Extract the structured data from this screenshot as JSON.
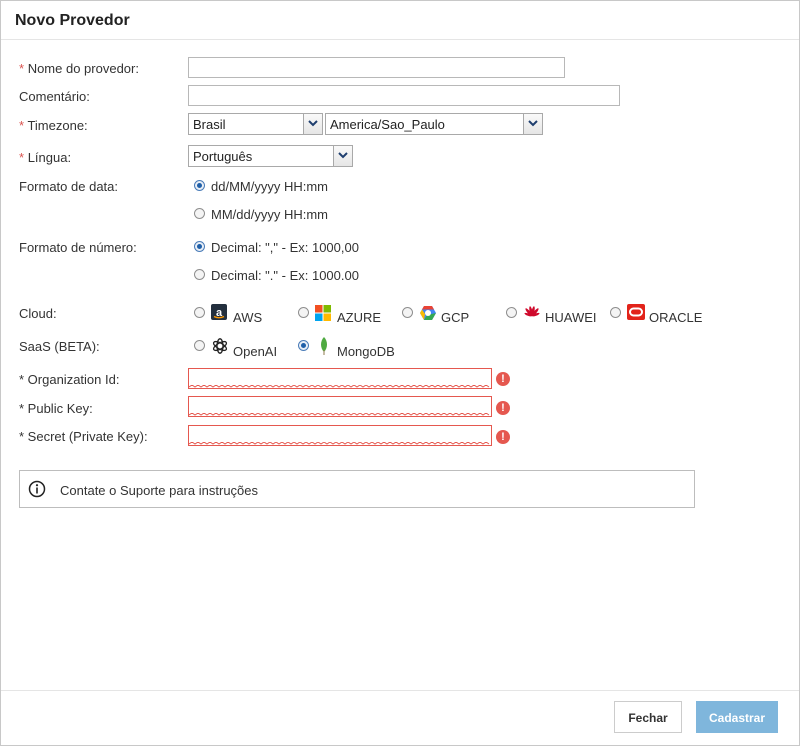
{
  "dialog": {
    "title": "Novo Provedor"
  },
  "form": {
    "required_mark": "*",
    "name_label": "Nome do provedor:",
    "name_value": "",
    "comment_label": "Comentário:",
    "comment_value": "",
    "timezone_label": "Timezone:",
    "timezone_country": "Brasil",
    "timezone_zone": "America/Sao_Paulo",
    "language_label": "Língua:",
    "language_value": "Português",
    "date_format_label": "Formato de data:",
    "date_formats": [
      {
        "label": "dd/MM/yyyy HH:mm",
        "selected": true
      },
      {
        "label": "MM/dd/yyyy HH:mm",
        "selected": false
      }
    ],
    "number_format_label": "Formato de número:",
    "number_formats": [
      {
        "label": "Decimal: \",\" - Ex: 1000,00",
        "selected": true
      },
      {
        "label": "Decimal: \".\" - Ex: 1000.00",
        "selected": false
      }
    ],
    "cloud_label": "Cloud:",
    "clouds": [
      {
        "label": "AWS",
        "icon": "aws-icon",
        "selected": false
      },
      {
        "label": "AZURE",
        "icon": "azure-icon",
        "selected": false
      },
      {
        "label": "GCP",
        "icon": "gcp-icon",
        "selected": false
      },
      {
        "label": "HUAWEI",
        "icon": "huawei-icon",
        "selected": false
      },
      {
        "label": "ORACLE",
        "icon": "oracle-icon",
        "selected": false
      }
    ],
    "saas_label": "SaaS (BETA):",
    "saas": [
      {
        "label": "OpenAI",
        "icon": "openai-icon",
        "selected": false
      },
      {
        "label": "MongoDB",
        "icon": "mongodb-icon",
        "selected": true
      }
    ],
    "org_id_label": "* Organization Id:",
    "public_key_label": "* Public Key:",
    "secret_label": "* Secret (Private Key):",
    "error_glyph": "!"
  },
  "info": {
    "text": "Contate o Suporte para instruções",
    "icon": "info-icon"
  },
  "footer": {
    "close_label": "Fechar",
    "save_label": "Cadastrar"
  },
  "colors": {
    "required": "#d9534f",
    "error": "#e5584f",
    "primary_disabled": "#7fb6dc",
    "radio_selected": "#1f5fa8"
  }
}
